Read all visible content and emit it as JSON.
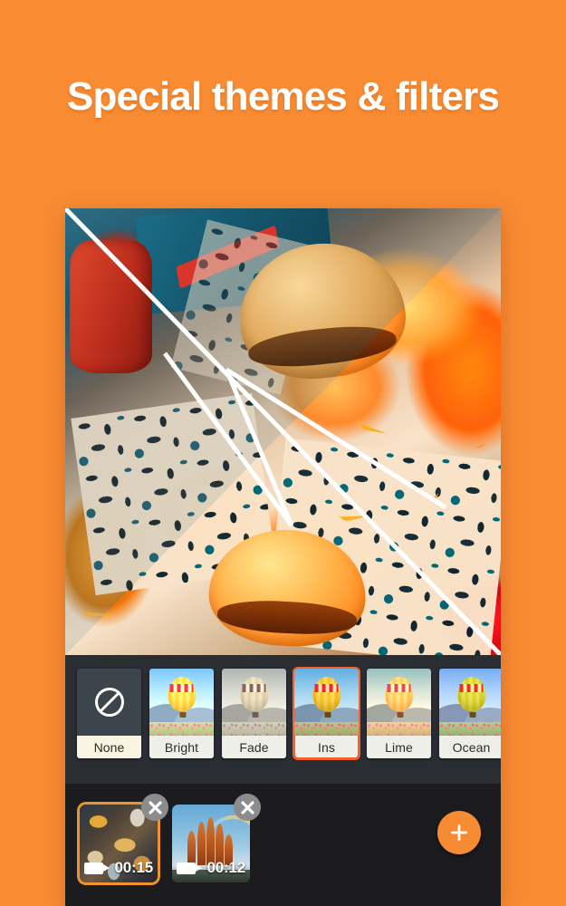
{
  "theme": {
    "background_color": "#F98B33",
    "accent_color": "#F4602A",
    "panel_color": "#2A2E33",
    "timeline_color": "#1C1C1E",
    "fab_color": "#F68B34"
  },
  "headline": {
    "text": "Special themes & filters"
  },
  "preview": {
    "name": "video-preview",
    "description": "Burgers and fries flat lay with diagonal filter split lines"
  },
  "filters": {
    "selected": "Ins",
    "items": [
      {
        "label": "None",
        "icon": "no-filter-icon",
        "selected": false
      },
      {
        "label": "Bright",
        "icon": "balloon-thumb",
        "selected": false
      },
      {
        "label": "Fade",
        "icon": "balloon-thumb",
        "selected": false
      },
      {
        "label": "Ins",
        "icon": "balloon-thumb",
        "selected": true
      },
      {
        "label": "Lime",
        "icon": "balloon-thumb",
        "selected": false
      },
      {
        "label": "Ocean",
        "icon": "balloon-thumb",
        "selected": false
      }
    ]
  },
  "timeline": {
    "clips": [
      {
        "duration": "00:15",
        "icon": "video-camera-icon",
        "close_icon": "close-icon",
        "selected": true
      },
      {
        "duration": "00:12",
        "icon": "video-camera-icon",
        "close_icon": "close-icon",
        "selected": false
      }
    ],
    "add_button": {
      "label": "+",
      "icon": "plus-icon"
    }
  }
}
